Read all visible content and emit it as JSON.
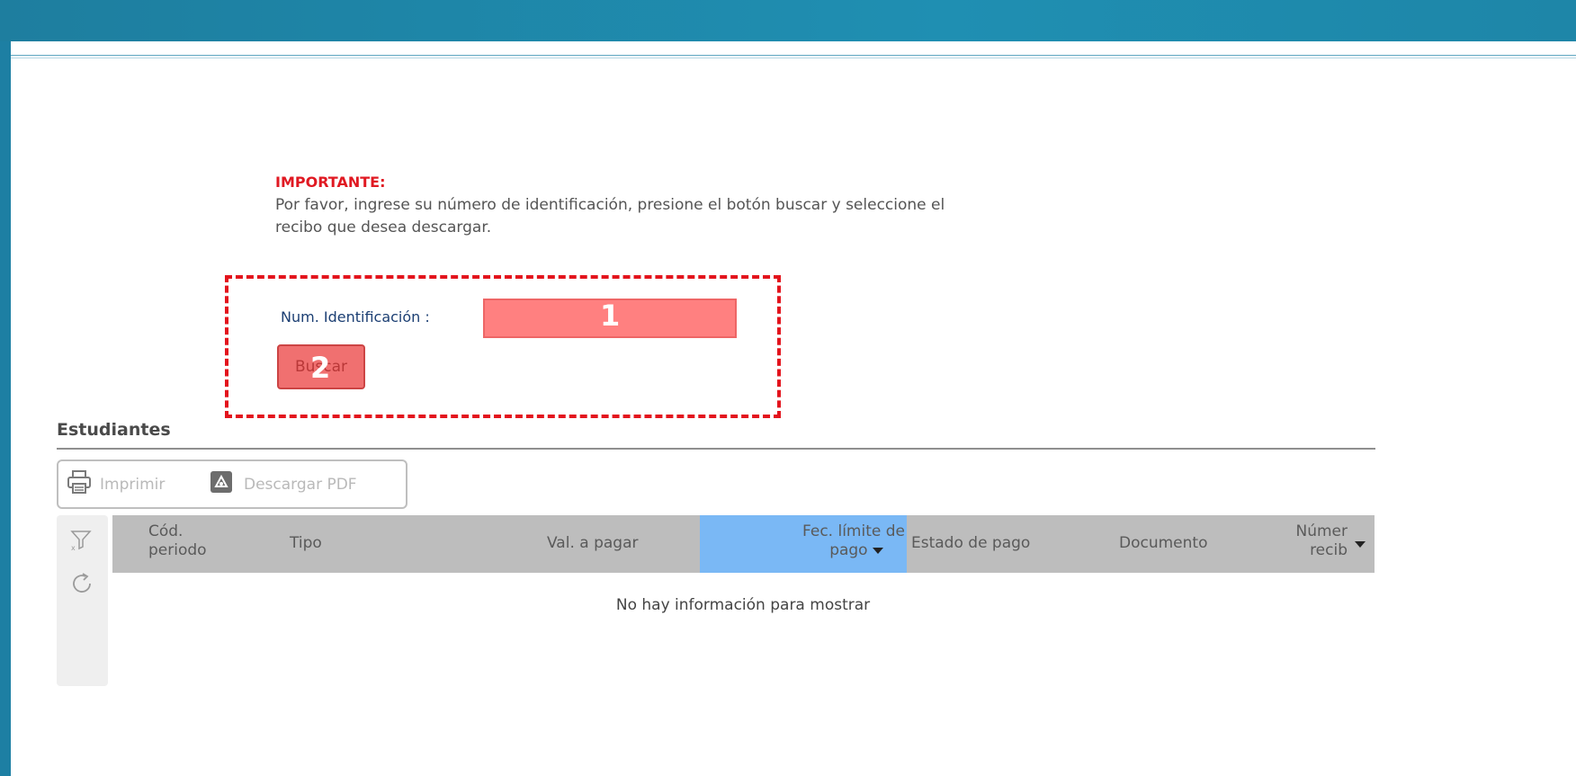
{
  "important": {
    "title": "IMPORTANTE:",
    "line1": "Por favor, ingrese su número de identificación, presione el botón buscar y seleccione el",
    "line2": "recibo que desea descargar."
  },
  "form": {
    "id_label": "Num. Identificación :",
    "id_value": "",
    "search_button": "Buscar",
    "marker_1": "1",
    "marker_2": "2"
  },
  "section": {
    "title": "Estudiantes"
  },
  "toolbar": {
    "print_label": "Imprimir",
    "pdf_label": "Descargar PDF"
  },
  "table": {
    "columns": [
      {
        "line1": "Cód.",
        "line2": "periodo"
      },
      {
        "line1": "Tipo",
        "line2": ""
      },
      {
        "line1": "Val. a pagar",
        "line2": ""
      },
      {
        "line1": "Fec. límite de",
        "line2": "pago"
      },
      {
        "line1": "Estado de pago",
        "line2": ""
      },
      {
        "line1": "Documento",
        "line2": ""
      },
      {
        "line1": "Númer",
        "line2": "recib"
      }
    ],
    "empty_message": "No hay información para mostrar"
  },
  "colors": {
    "header_bar": "#1f8fb2",
    "important": "#e01922",
    "sorted_column": "#7ab8f5",
    "highlight": "#ff8080"
  }
}
